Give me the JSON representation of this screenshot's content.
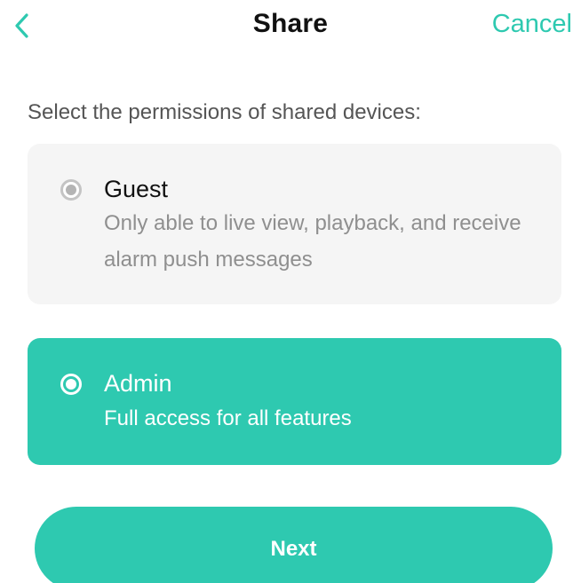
{
  "colors": {
    "accent": "#2ec9b0"
  },
  "header": {
    "back_icon": "chevron-left-icon",
    "title": "Share",
    "cancel_label": "Cancel"
  },
  "prompt": "Select the permissions of shared devices:",
  "options": [
    {
      "title": "Guest",
      "description": "Only able to live view, playback, and receive alarm push messages",
      "selected": false
    },
    {
      "title": "Admin",
      "description": "Full access for all features",
      "selected": true
    }
  ],
  "next_label": "Next"
}
